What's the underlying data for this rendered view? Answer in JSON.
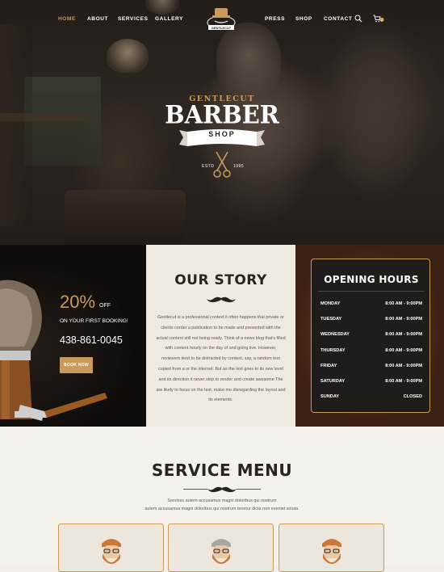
{
  "nav": {
    "left_items": [
      "HOME",
      "ABOUT",
      "SERVICES",
      "GALLERY"
    ],
    "right_items": [
      "PRESS",
      "SHOP",
      "CONTACT"
    ],
    "active": "HOME",
    "logo_text": "GENTLECUT",
    "icons": [
      "search-icon",
      "cart-icon"
    ],
    "cart_count": "0"
  },
  "hero": {
    "brand_small": "GENTLECUT",
    "brand_big": "BARBER",
    "ribbon": "SHOP",
    "est_left": "ESTD",
    "est_right": "1995"
  },
  "promo": {
    "percent": "20%",
    "off": "OFF",
    "line": "ON YOUR FIRST BOOKING!",
    "phone": "438-861-0045",
    "button": "BOOK NOW"
  },
  "story": {
    "title": "OUR STORY",
    "body": "Gentlecut is a professional context it often happens that private or clients corder a publication to be made and presented with the actual content still not being ready. Think of a news blog that's filled with content hourly on the day of and going live. However, reviewers tend to be distracted by content, say, a random text copied from a or the internet. But as the text goes to its new level and its direction it never stop to render and create awesome The are likely to focus on the text, make me disregarding the layout and its elements."
  },
  "hours": {
    "title": "OPENING HOURS",
    "rows": [
      {
        "day": "MONDAY",
        "time": "8:00 AM - 9:00PM"
      },
      {
        "day": "TUESDAY",
        "time": "8:00 AM - 9:00PM"
      },
      {
        "day": "WEDNESDAY",
        "time": "8:00 AM - 9:00PM"
      },
      {
        "day": "THURSDAY",
        "time": "8:00 AM - 9:00PM"
      },
      {
        "day": "FRIDAY",
        "time": "8:00 AM - 9:00PM"
      },
      {
        "day": "SATURDAY",
        "time": "8:00 AM - 9:00PM"
      },
      {
        "day": "SUNDAY",
        "time": "CLOSED"
      }
    ]
  },
  "services": {
    "title": "SERVICE MENU",
    "sub_line1": "Services autem accusamus magni doloribus qui nostrum",
    "sub_line2": "autem accusamus magni doloribus qui nostrum tenetur dicta rem eveniet soluta."
  },
  "colors": {
    "accent": "#c99a5b",
    "dark": "#2a2420",
    "hours_card": "#1f1d1c"
  }
}
